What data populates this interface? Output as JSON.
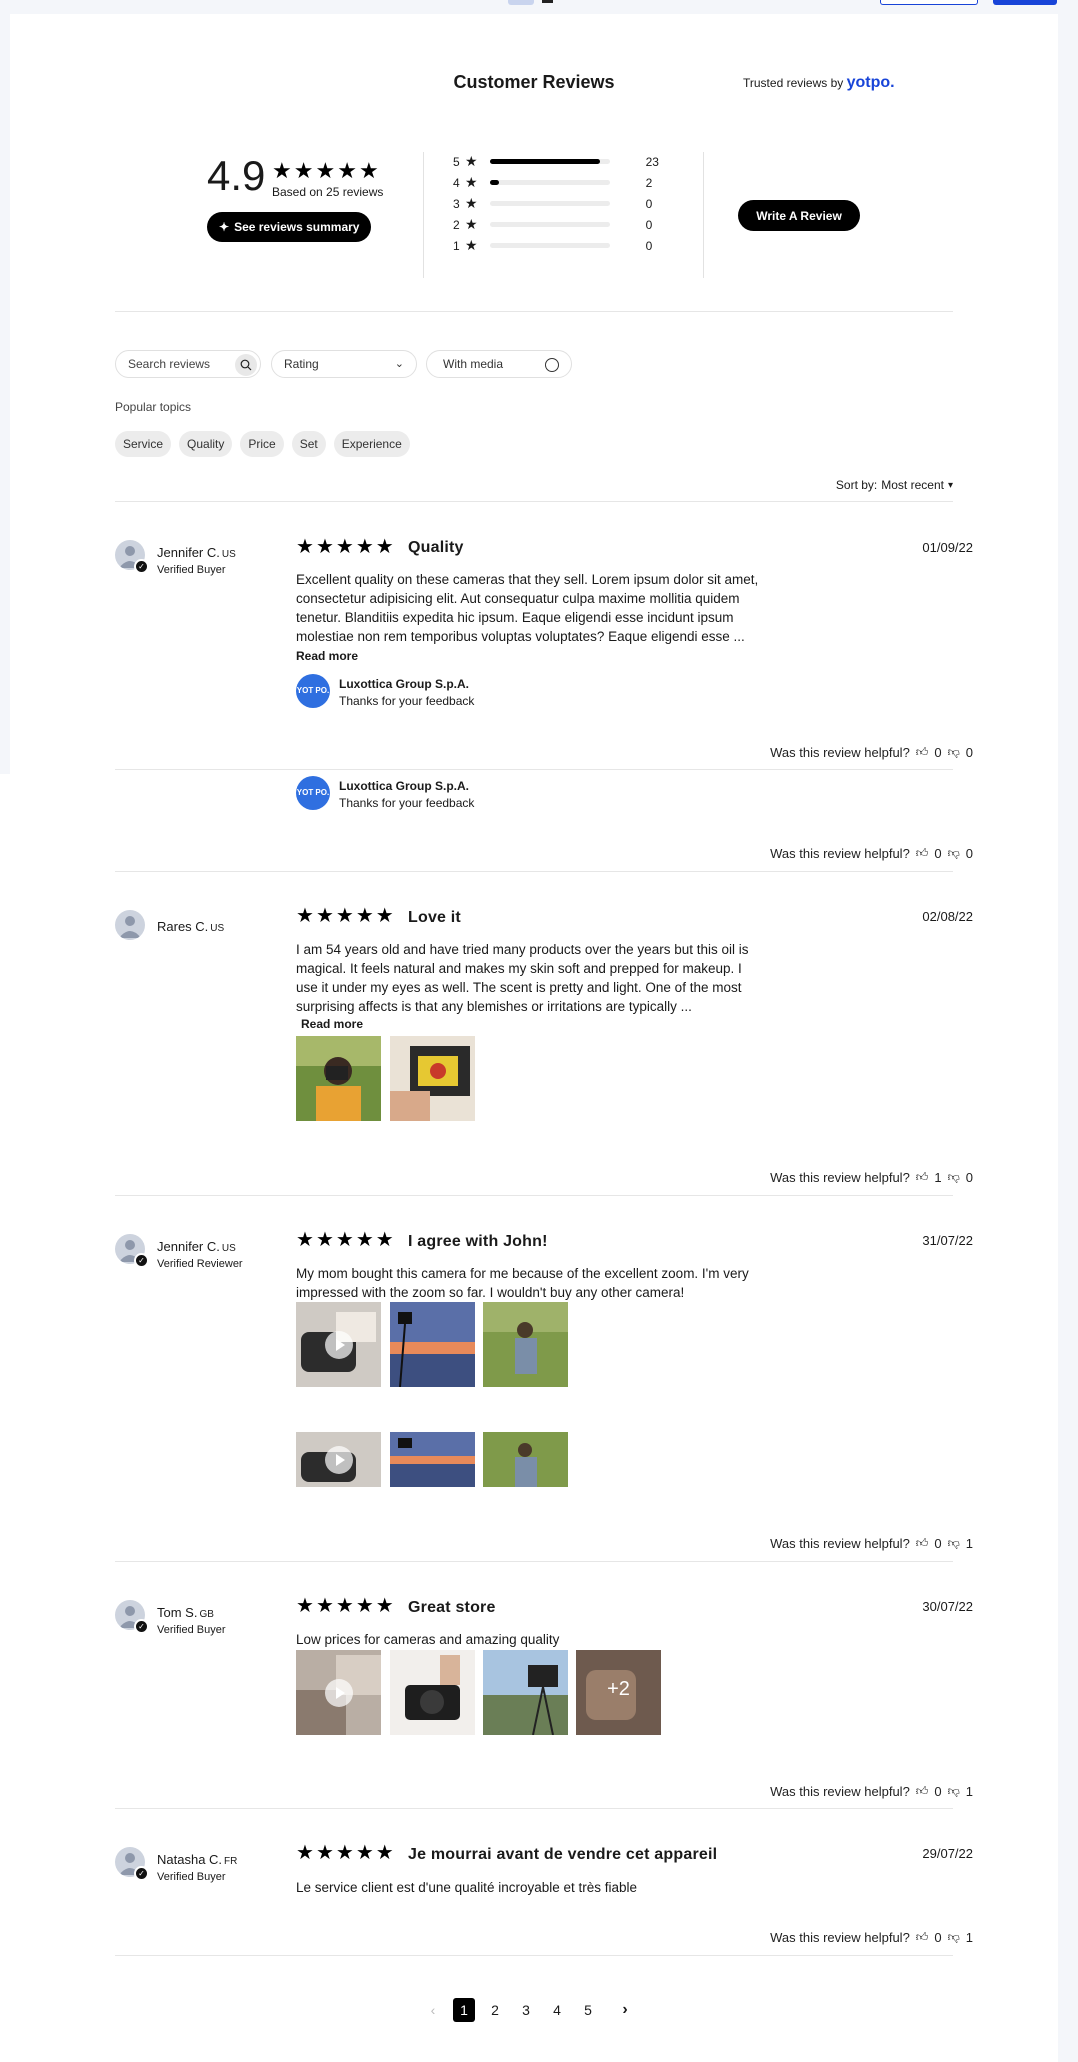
{
  "widget": {
    "title": "Customer Reviews",
    "trusted_prefix": "Trusted reviews by",
    "trusted_brand": "yotpo.",
    "score": "4.9",
    "based_on": "Based on 25 reviews",
    "summary_button": "See reviews summary",
    "write_button": "Write A Review",
    "distribution": [
      {
        "stars": "5",
        "count": "23",
        "fraction": 0.92
      },
      {
        "stars": "4",
        "count": "2",
        "fraction": 0.08
      },
      {
        "stars": "3",
        "count": "0",
        "fraction": 0
      },
      {
        "stars": "2",
        "count": "0",
        "fraction": 0
      },
      {
        "stars": "1",
        "count": "0",
        "fraction": 0
      }
    ]
  },
  "filters": {
    "search_placeholder": "Search reviews",
    "rating_label": "Rating",
    "media_label": "With media",
    "topics_heading": "Popular topics",
    "topics": [
      "Service",
      "Quality",
      "Price",
      "Set",
      "Experience"
    ],
    "sort_label": "Sort by:",
    "sort_value": "Most recent"
  },
  "helpful_label": "Was this review helpful?",
  "read_more": "Read more",
  "reply": {
    "logo": "YOT PO.",
    "company": "Luxottica Group S.p.A.",
    "text": "Thanks for your feedback"
  },
  "reviews": [
    {
      "name": "Jennifer C.",
      "country": "US",
      "badge": "Verified Buyer",
      "title": "Quality",
      "date": "01/09/22",
      "body": "Excellent quality on these cameras that they sell. Lorem ipsum dolor sit amet, consectetur adipisicing elit. Aut consequatur culpa maxime mollitia quidem tenetur. Blanditiis expedita hic ipsum. Eaque eligendi esse incidunt ipsum molestiae non rem temporibus voluptas voluptates? Eaque eligendi esse ...",
      "up": "0",
      "down": "0",
      "up2": "0",
      "down2": "0"
    },
    {
      "name": "Rares C.",
      "country": "US",
      "badge": "",
      "title": "Love it",
      "date": "02/08/22",
      "body": "I am 54 years old and have tried many products over the years but this oil is magical. It feels natural and makes my skin soft and prepped for makeup. I use it under my eyes as well. The scent is pretty and light. One of the most surprising affects is that any blemishes or irritations are typically ...",
      "up": "1",
      "down": "0"
    },
    {
      "name": "Jennifer C.",
      "country": "US",
      "badge": "Verified Reviewer",
      "title": "I agree with John!",
      "date": "31/07/22",
      "body": "My mom bought this camera for me because of the excellent zoom. I'm very impressed with the zoom so far. I wouldn't buy any other camera!",
      "up": "0",
      "down": "1"
    },
    {
      "name": "Tom S.",
      "country": "GB",
      "badge": "Verified Buyer",
      "title": "Great store",
      "date": "30/07/22",
      "body": "Low prices for cameras and amazing quality",
      "more_media": "+2",
      "up": "0",
      "down": "1"
    },
    {
      "name": "Natasha C.",
      "country": "FR",
      "badge": "Verified Buyer",
      "title": "Je mourrai avant de vendre cet appareil",
      "date": "29/07/22",
      "body": "Le service client est d'une qualité incroyable et très fiable",
      "up": "0",
      "down": "1"
    }
  ],
  "pagination": {
    "pages": [
      "1",
      "2",
      "3",
      "4",
      "5"
    ],
    "current": "1"
  }
}
